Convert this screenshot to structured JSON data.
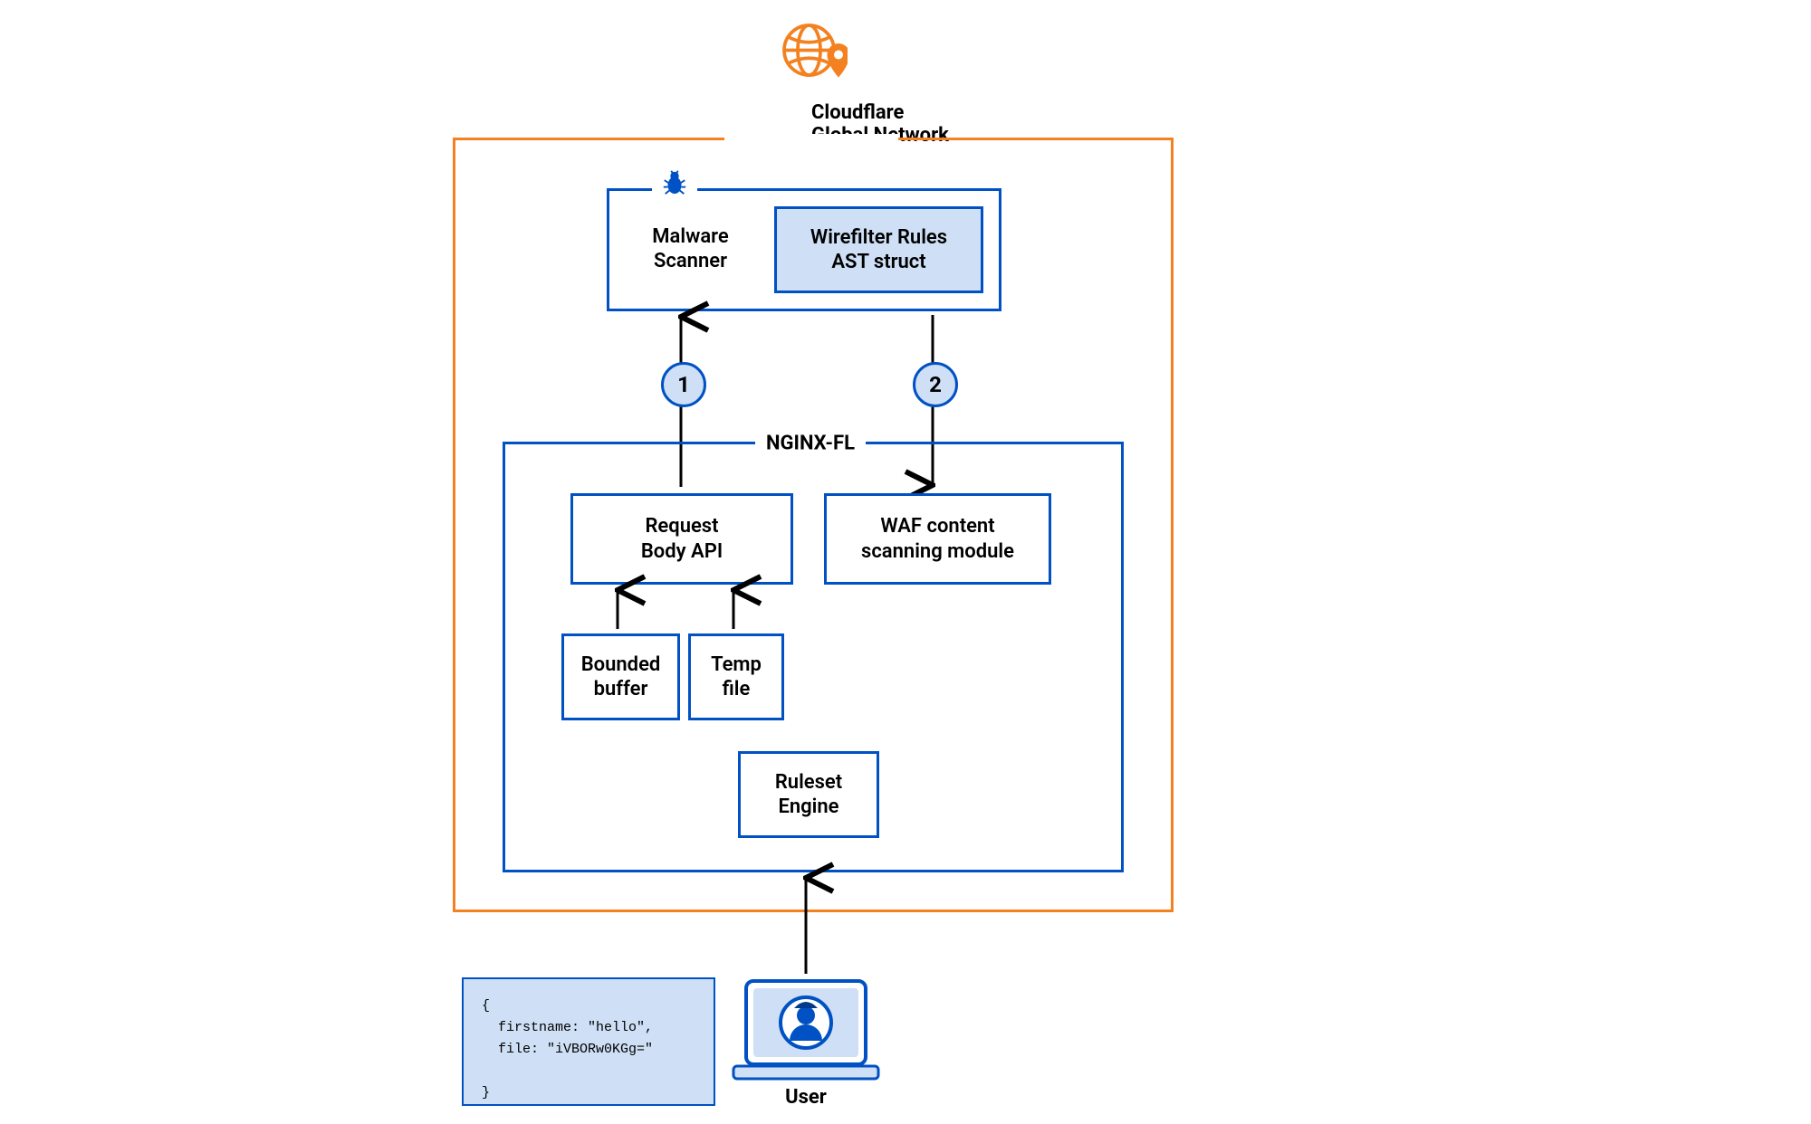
{
  "title": {
    "line1": "Cloudflare",
    "line2": "Global Network"
  },
  "nginx_label": "NGINX-FL",
  "scanner": {
    "malware": "Malware\nScanner",
    "wirefilter": "Wirefilter Rules\nAST struct"
  },
  "nginx": {
    "request_body_api": "Request\nBody API",
    "waf_module": "WAF content\nscanning module",
    "bounded_buffer": "Bounded\nbuffer",
    "temp_file": "Temp\nfile",
    "ruleset_engine": "Ruleset\nEngine"
  },
  "steps": {
    "one": "1",
    "two": "2"
  },
  "user": {
    "label": "User",
    "payload": "{\n  firstname: \"hello\",\n  file: \"iVBORw0KGg=\"\n\n}"
  },
  "icons": {
    "globe": "globe-location-icon",
    "bug": "bug-icon",
    "avatar": "avatar-icon",
    "laptop": "laptop-icon"
  },
  "colors": {
    "orange": "#f48120",
    "blue": "#0051c3",
    "light_blue": "#cfe0f6"
  }
}
